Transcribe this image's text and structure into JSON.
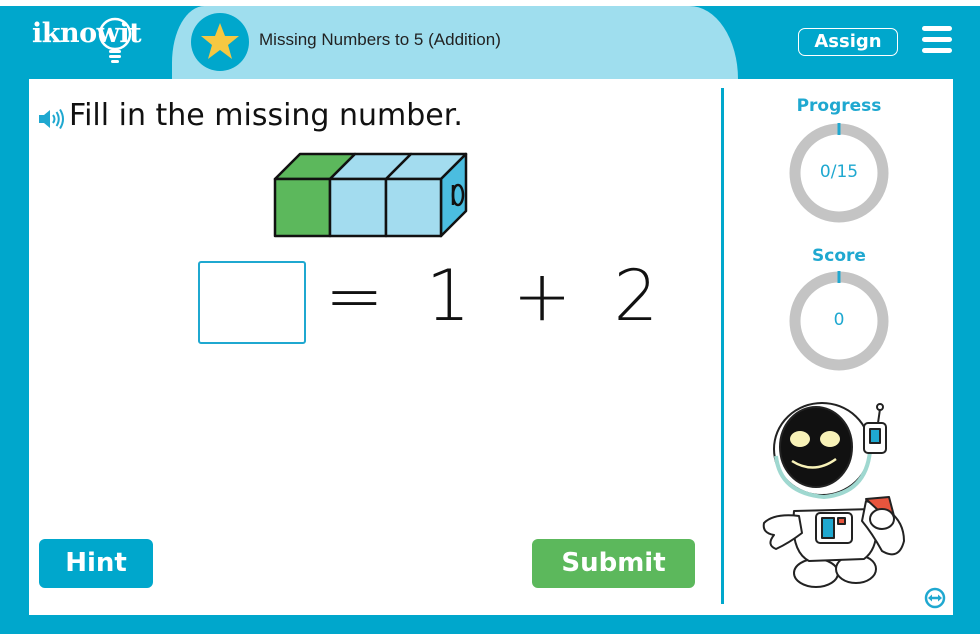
{
  "header": {
    "logo": "iknowit",
    "lesson_title": "Missing Numbers to 5 (Addition)",
    "assign_label": "Assign",
    "menu_icon": "hamburger-menu-icon",
    "lesson_icon": "star-icon"
  },
  "question": {
    "sound_icon": "speaker-icon",
    "prompt": "Fill in the missing number.",
    "answer_value": "",
    "equation": {
      "equals": "=",
      "addend1": "1",
      "plus": "+",
      "addend2": "2"
    },
    "cubes": {
      "green": 1,
      "blue": 2
    }
  },
  "buttons": {
    "hint": "Hint",
    "submit": "Submit"
  },
  "sidebar": {
    "progress_label": "Progress",
    "progress_value": "0/15",
    "progress_fraction": 0,
    "score_label": "Score",
    "score_value": "0",
    "mascot": "astronaut",
    "resize_icon": "expand-horizontal-icon"
  },
  "colors": {
    "brand_blue": "#00a7cc",
    "light_blue": "#9fdeee",
    "submit_green": "#5cb85c",
    "cube_green": "#5cb85c",
    "cube_blue": "#a3dcef",
    "ring_gray": "#c4c4c4",
    "star_yellow": "#f5c842"
  }
}
